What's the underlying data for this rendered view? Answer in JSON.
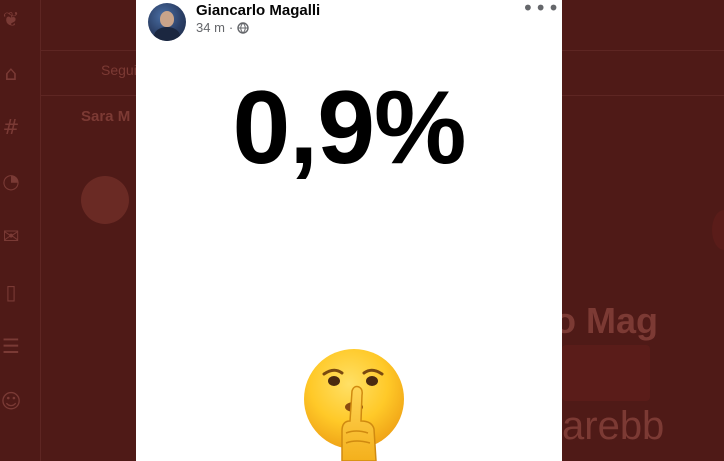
{
  "background": {
    "sidebar_icons": [
      "home-icon",
      "hashtag-icon",
      "bell-icon",
      "mail-icon",
      "bookmark-icon",
      "list-icon",
      "profile-icon"
    ],
    "left_text": [
      "Segui",
      "Sara M"
    ],
    "right_text": [
      "o Mag",
      "arebb"
    ]
  },
  "post": {
    "author": "Giancarlo Magalli",
    "time": "34 m",
    "separator": "·",
    "more_label": "•••",
    "big_text": "0,9%",
    "emoji": "shushing-face-emoji"
  },
  "colors": {
    "overlay": "#4f1a17",
    "card": "#ffffff",
    "text": "#000000",
    "muted": "#65676b"
  }
}
